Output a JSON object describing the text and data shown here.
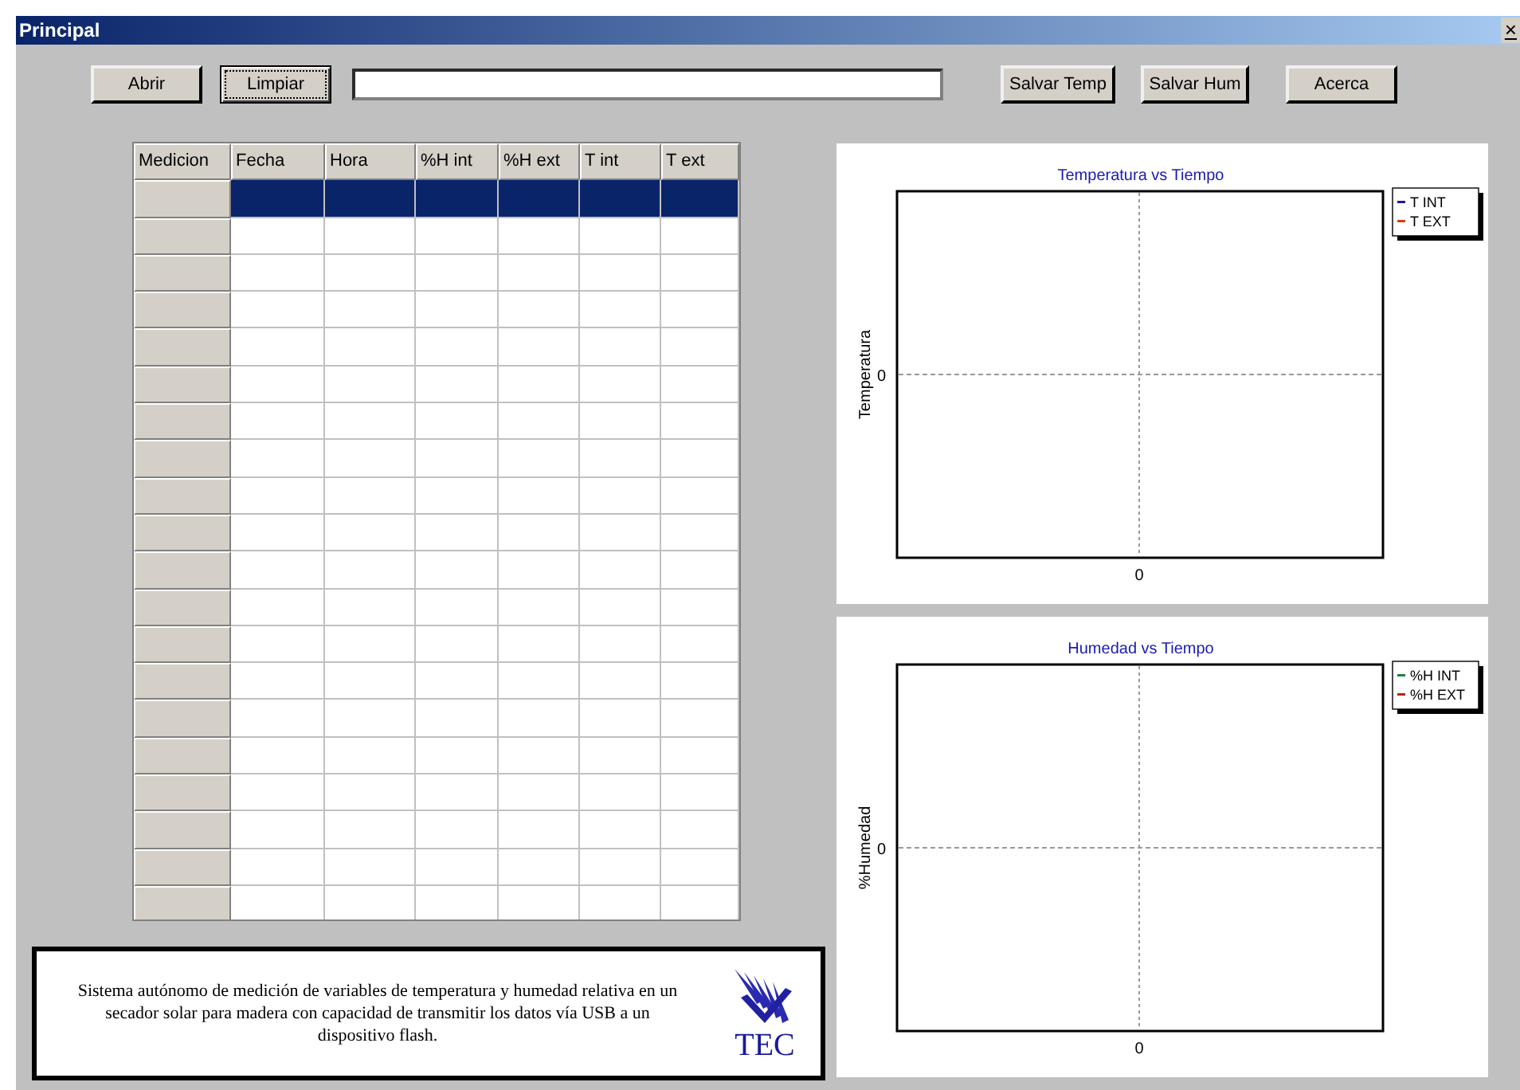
{
  "window": {
    "title": "Principal",
    "close": "×"
  },
  "toolbar": {
    "buttons_left": [
      {
        "label": "Abrir",
        "focused": false
      },
      {
        "label": "Limpiar",
        "focused": true
      }
    ],
    "buttons_right": [
      {
        "label": "Salvar Temp"
      },
      {
        "label": "Salvar Hum"
      },
      {
        "label": "Acerca"
      }
    ]
  },
  "table": {
    "columns": [
      "Medicion",
      "Fecha",
      "Hora",
      "%H int",
      "%H ext",
      "T int",
      "T ext"
    ],
    "rows": [
      {
        "selected": true
      },
      {
        "selected": false
      },
      {
        "selected": false
      },
      {
        "selected": false
      },
      {
        "selected": false
      },
      {
        "selected": false
      },
      {
        "selected": false
      },
      {
        "selected": false
      },
      {
        "selected": false
      },
      {
        "selected": false
      },
      {
        "selected": false
      },
      {
        "selected": false
      },
      {
        "selected": false
      },
      {
        "selected": false
      },
      {
        "selected": false
      },
      {
        "selected": false
      },
      {
        "selected": false
      },
      {
        "selected": false
      },
      {
        "selected": false
      },
      {
        "selected": false
      }
    ]
  },
  "info": {
    "text": "Sistema autónomo de medición de variables de temperatura y humedad relativa en un secador solar para madera con capacidad de transmitir los datos vía USB a un dispositivo flash.",
    "logo_text": "TEC"
  },
  "charts": [
    {
      "title": "Temperatura vs Tiempo",
      "ylabel": "Temperatura",
      "ytick": "0",
      "xtick": "0",
      "legend": [
        {
          "label": "T INT",
          "color": "#1a1aa0"
        },
        {
          "label": "T EXT",
          "color": "#d04010"
        }
      ]
    },
    {
      "title": "Humedad vs Tiempo",
      "ylabel": "%Humedad",
      "ytick": "0",
      "xtick": "0",
      "legend": [
        {
          "label": "%H INT",
          "color": "#208040"
        },
        {
          "label": "%H EXT",
          "color": "#c02010"
        }
      ]
    }
  ]
}
